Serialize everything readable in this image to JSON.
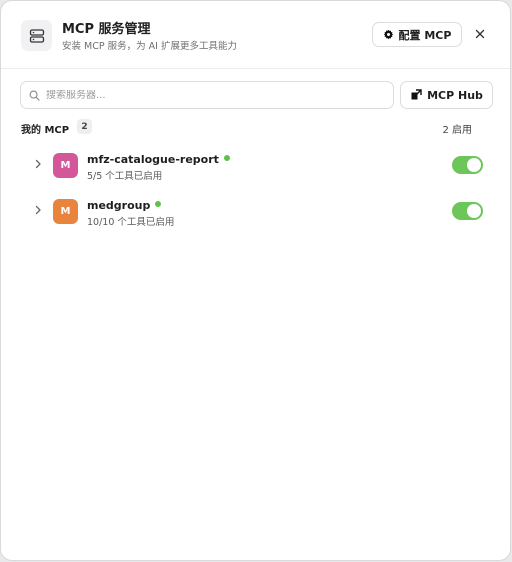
{
  "header": {
    "title": "MCP 服务管理",
    "subtitle": "安装 MCP 服务，为 AI 扩展更多工具能力",
    "config_label": "配置 MCP",
    "close_icon": "close-icon",
    "server_icon": "server-stack-icon"
  },
  "search": {
    "placeholder": "搜索服务器...",
    "value": "",
    "icon": "search-icon"
  },
  "hub_button": {
    "label": "MCP Hub",
    "icon": "hub-icon"
  },
  "section": {
    "title": "我的 MCP",
    "count": "2",
    "enabled_text": "2 启用"
  },
  "servers": [
    {
      "name": "mfz-catalogue-report",
      "initial": "M",
      "tools": "5/5 个工具已启用",
      "avatar_color": "#d4579a",
      "status": "online",
      "enabled": true
    },
    {
      "name": "medgroup",
      "initial": "M",
      "tools": "10/10 个工具已启用",
      "avatar_color": "#e8843d",
      "status": "online",
      "enabled": true
    }
  ],
  "colors": {
    "status_online": "#5cc24a",
    "toggle_on": "#6cc65a"
  }
}
